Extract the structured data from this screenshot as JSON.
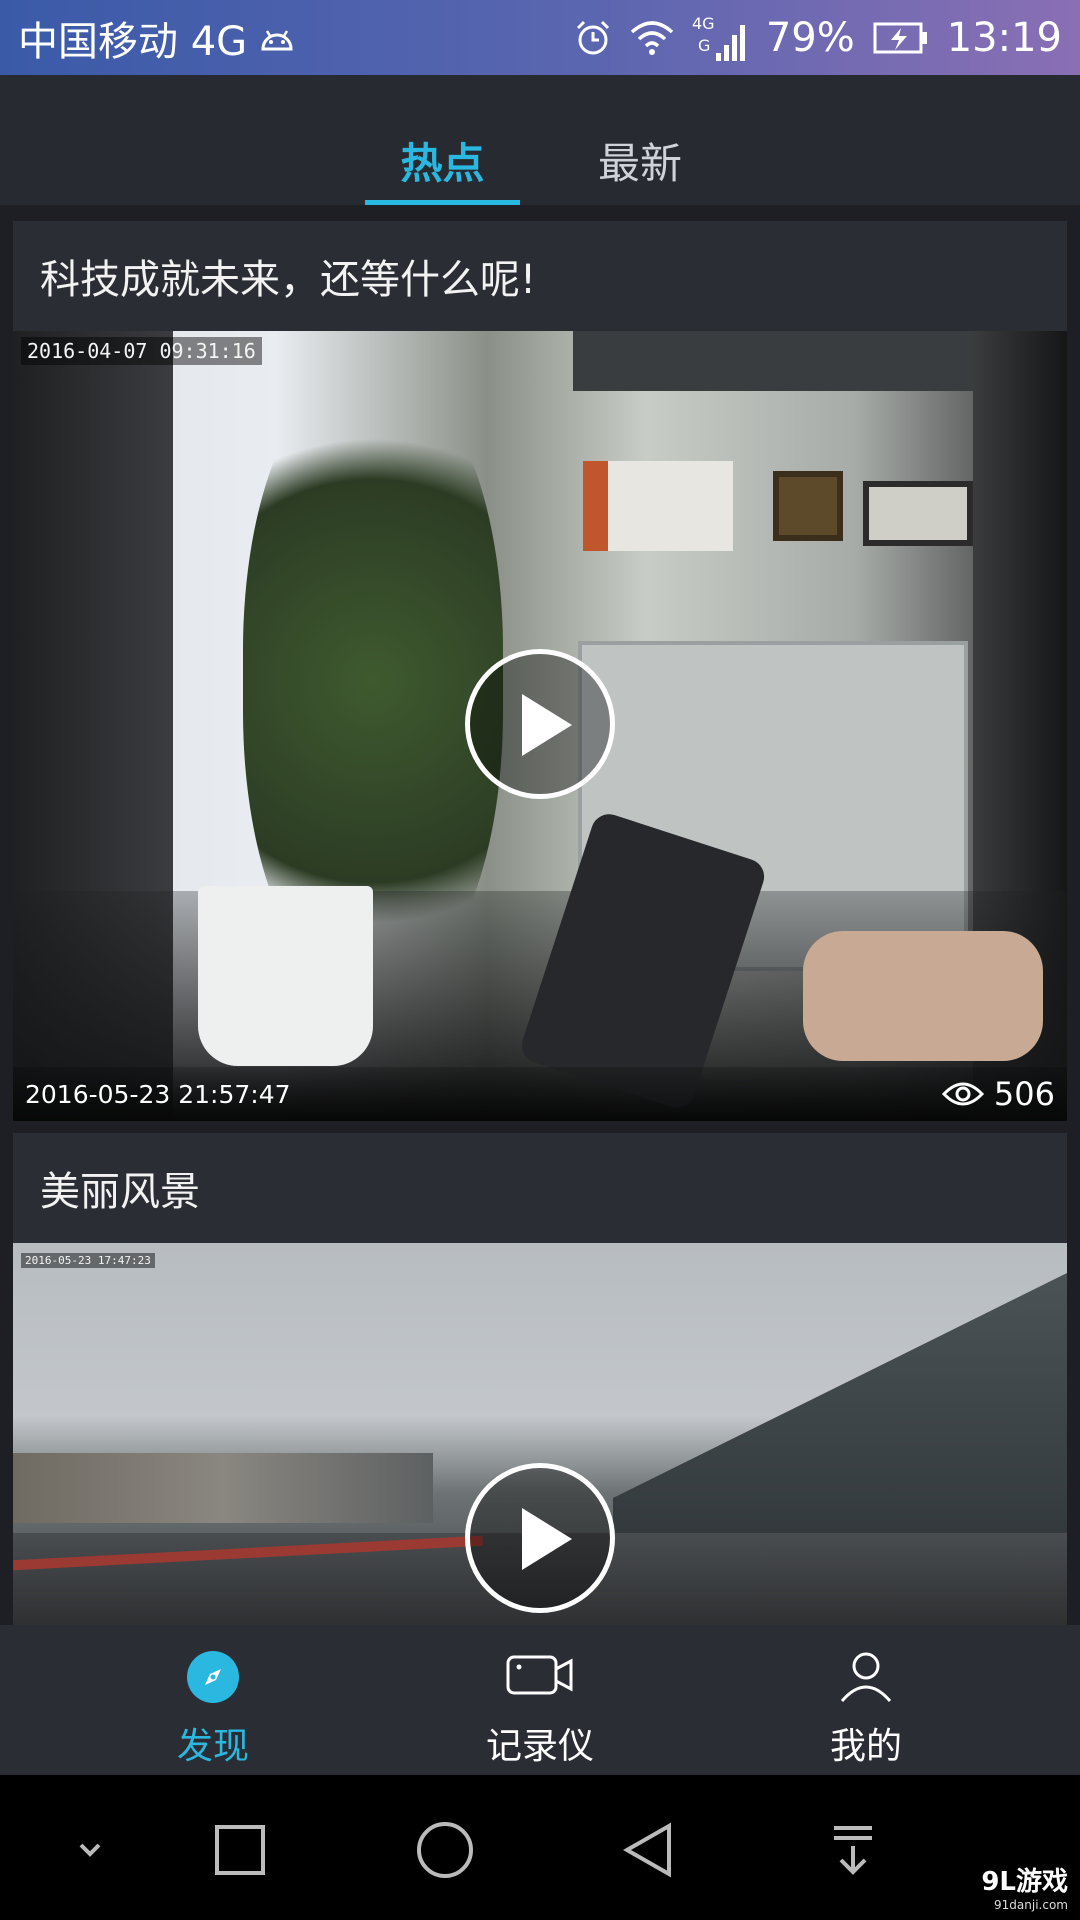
{
  "status_bar": {
    "carrier": "中国移动 4G",
    "battery": "79%",
    "time": "13:19"
  },
  "tabs": [
    {
      "label": "热点",
      "active": true
    },
    {
      "label": "最新",
      "active": false
    }
  ],
  "feed": [
    {
      "title": "科技成就未来，还等什么呢!",
      "osd_timestamp": "2016-04-07 09:31:16",
      "date": "2016-05-23 21:57:47",
      "views": "506"
    },
    {
      "title": "美丽风景",
      "osd_timestamp": "2016-05-23 17:47:23"
    }
  ],
  "bottom_nav": [
    {
      "label": "发现",
      "icon": "compass-icon",
      "active": true
    },
    {
      "label": "记录仪",
      "icon": "camera-icon",
      "active": false
    },
    {
      "label": "我的",
      "icon": "person-icon",
      "active": false
    }
  ],
  "watermark": {
    "main": "9L游戏",
    "sub": "91danji.com"
  },
  "colors": {
    "accent": "#2ab8e0",
    "background": "#22252b",
    "card": "#2a2d34"
  }
}
